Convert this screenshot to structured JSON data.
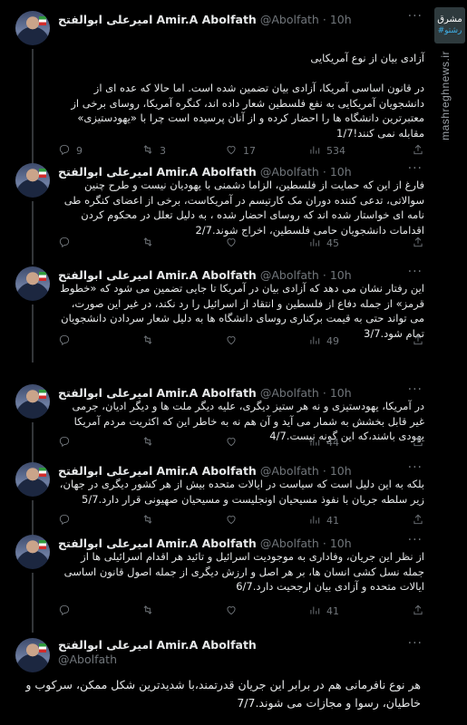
{
  "user": {
    "name": "Amir.A Abolfath",
    "name_fa": "امیرعلی ابوالفتح",
    "handle": "@Abolfath"
  },
  "tweets": [
    {
      "time": "10h",
      "text": "آزادی بیان از نوع آمریکایی\n\nدر قانون اساسی آمریکا، آزادی بیان تضمین شده است. اما حالا که عده ای از دانشجویان آمریکایی به نفع فلسطین شعار داده اند، کنگره آمریکا، روسای برخی از معتبرترین دانشگاه ها را احضار کرده و از آنان پرسیده است چرا با «یهودستیزی» مقابله نمی کنند!1/7",
      "replies": "9",
      "retweets": "3",
      "likes": "17",
      "views": "534"
    },
    {
      "time": "10h",
      "text": "فارغ از این که حمایت از فلسطین، الزاما دشمنی با یهودیان نیست و طرح چنین سوالاتی، تدعی کننده دوران مک کارتیسم در آمریکاست، برخی از اعضای کنگره طی نامه ای خواستار شده اند که روسای احضار شده ، به دلیل تعلل در محکوم کردن اقدامات دانشجویان حامی فلسطین، اخراج شوند.2/7",
      "replies": "",
      "retweets": "",
      "likes": "",
      "views": "45"
    },
    {
      "time": "10h",
      "text": "این رفتار نشان می دهد که آزادی بیان در آمریکا تا جایی تضمین می شود که «خطوط قرمز» از جمله دفاع از فلسطین و انتقاد از اسرائیل را رد نکند، در غیر این صورت، می تواند حتی به قیمت برکناری روسای دانشگاه ها به دلیل شعار سردادن دانشجویان تمام شود.3/7",
      "replies": "",
      "retweets": "",
      "likes": "",
      "views": "49"
    },
    {
      "time": "10h",
      "text": "در آمریکا، یهودستیزی و نه هر ستیز دیگری، علیه دیگر ملت ها و دیگر ادیان، جرمی غیر قابل بخشش به شمار می آید و آن هم نه به خاطر این که اکثریت مردم آمریکا یهودی باشند،که این گونه نیست.4/7",
      "replies": "",
      "retweets": "",
      "likes": "",
      "views": "44"
    },
    {
      "time": "10h",
      "text": "بلکه به این دلیل است که سیاست در ایالات متحده بیش از هر کشور دیگری در جهان، زیر سلطه جریان با نفوذ مسیحیان اونجلیست و مسیحیان صهیونی قرار دارد.5/7",
      "replies": "",
      "retweets": "",
      "likes": "",
      "views": "41"
    },
    {
      "time": "10h",
      "text": "از نظر این جریان، وفاداری به موجودیت اسرائیل و تائید هر اقدام اسرائیلی ها از جمله نسل کشی انسان ها، بر هر اصل و ارزش دیگری از جمله اصول قانون اساسی ایالات متحده و آزادی بیان ارجحیت دارد.6/7",
      "replies": "",
      "retweets": "",
      "likes": "",
      "views": "41"
    }
  ],
  "last_tweet": {
    "handle": "@Abolfath",
    "text": "هر نوع نافرمانی هم در برابر این جریان قدرتمند،با شدیدترین شکل ممکن، سرکوب و خاطیان، رسوا و مجازات می شوند.7/7"
  },
  "sidebar": {
    "logo_line1": "مشرق",
    "logo_line2": "#رشتو",
    "site": "mashreghnews.ir"
  }
}
